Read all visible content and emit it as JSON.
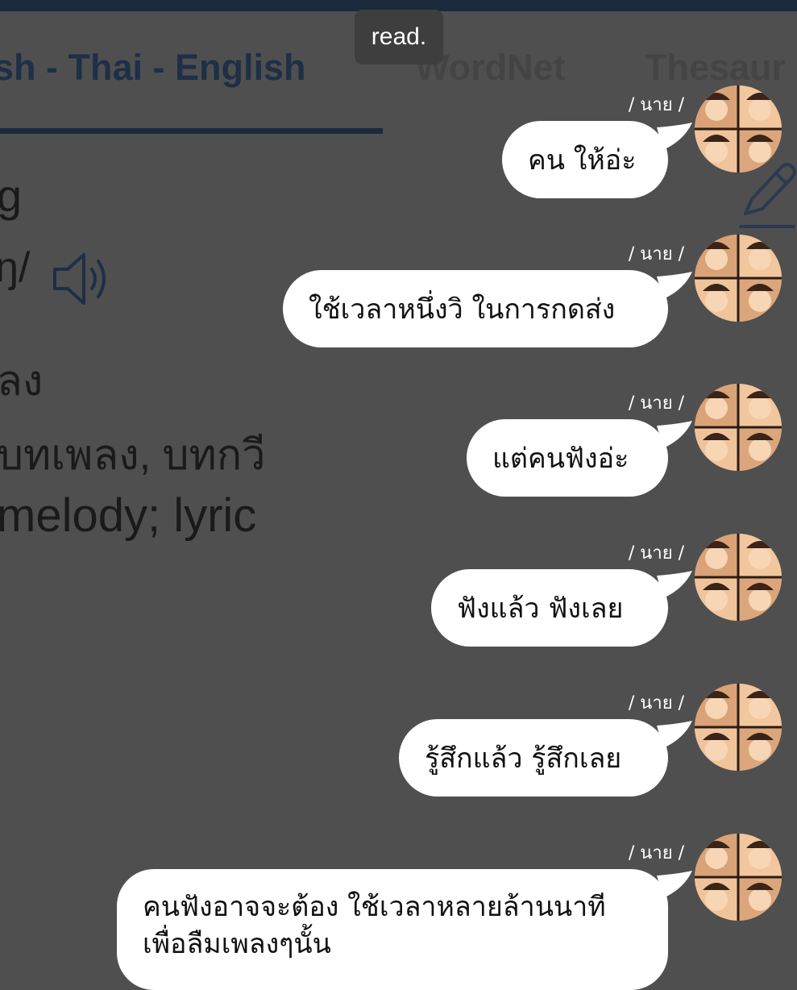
{
  "toast": {
    "text": "read."
  },
  "dictionary": {
    "tabs": [
      {
        "label": "sh - Thai - English"
      },
      {
        "label": "WordNet"
      },
      {
        "label": "Thesaur"
      }
    ],
    "word_fragment": "g",
    "phonetic_fragment": "ŋ/",
    "pos_fragment": "ลง",
    "thai_meaning": "บทเพลง, บทกวี",
    "english_meaning": "melody; lyric"
  },
  "messages": [
    {
      "sender": "/ นาย /",
      "text": "คน ให้อ่ะ"
    },
    {
      "sender": "/ นาย /",
      "text": "ใช้เวลาหนึ่งวิ ในการกดส่ง"
    },
    {
      "sender": "/ นาย /",
      "text": "แต่คนฟังอ่ะ"
    },
    {
      "sender": "/ นาย /",
      "text": "ฟังแล้ว ฟังเลย"
    },
    {
      "sender": "/ นาย /",
      "text": "รู้สึกแล้ว รู้สึกเลย"
    },
    {
      "sender": "/ นาย /",
      "text_line1": "คนฟังอาจจะต้อง ใช้เวลาหลายล้านนาที",
      "text_line2": "เพื่อลืมเพลงๆนั้น"
    }
  ],
  "colors": {
    "background": "#4f4f4f",
    "bubble": "#ffffff",
    "header_bar": "#1b2a3d"
  },
  "icons": [
    "speaker-icon",
    "pencil-icon",
    "avatar-image"
  ]
}
